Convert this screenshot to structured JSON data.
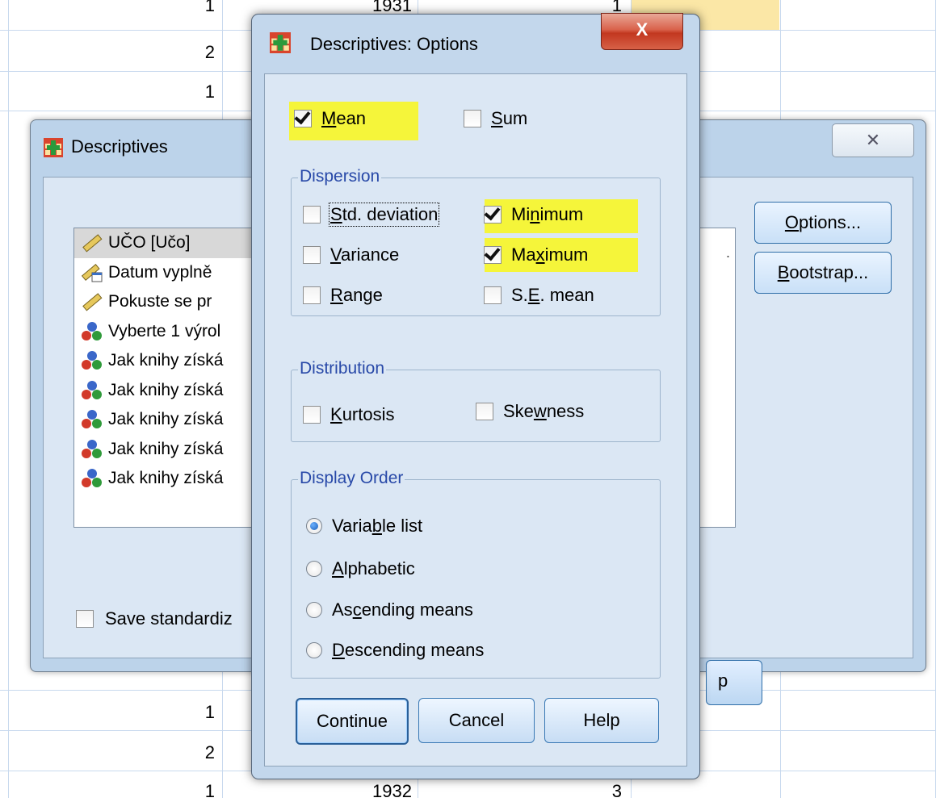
{
  "sheet": {
    "rows": [
      {
        "a": "1",
        "b": "1931",
        "c": "1"
      },
      {
        "a": "2",
        "b": "",
        "c": ""
      },
      {
        "a": "1",
        "b": "",
        "c": ""
      },
      {
        "a": "1",
        "b": "",
        "c": ""
      },
      {
        "a": "2",
        "b": "",
        "c": ""
      },
      {
        "a": "1",
        "b": "1932",
        "c": "3"
      }
    ]
  },
  "back_dialog": {
    "title": "Descriptives",
    "close_glyph": "✕",
    "variables": [
      {
        "label": "UČO [Učo]",
        "icon": "ruler-scale-icon"
      },
      {
        "label": "Datum vyplně",
        "icon": "date-scale-icon"
      },
      {
        "label": "Pokuste se pr",
        "icon": "ruler-scale-icon"
      },
      {
        "label": "Vyberte 1 výrol",
        "icon": "nominal-icon"
      },
      {
        "label": "Jak knihy získá",
        "icon": "nominal-icon"
      },
      {
        "label": "Jak knihy získá",
        "icon": "nominal-icon"
      },
      {
        "label": "Jak knihy získá",
        "icon": "nominal-icon"
      },
      {
        "label": "Jak knihy získá",
        "icon": "nominal-icon"
      },
      {
        "label": "Jak knihy získá",
        "icon": "nominal-icon"
      }
    ],
    "target_ellipsis": ".",
    "options_button": {
      "pre": "",
      "key": "O",
      "post": "ptions..."
    },
    "bootstrap_button": {
      "pre": "",
      "key": "B",
      "post": "ootstrap..."
    },
    "save_standardized": "Save standardiz",
    "bottom_partial_label": "p"
  },
  "options_dialog": {
    "title": "Descriptives: Options",
    "close_glyph": "X",
    "mean": {
      "pre": "",
      "key": "M",
      "post": "ean",
      "checked": true
    },
    "sum": {
      "pre": "",
      "key": "S",
      "post": "um",
      "checked": false
    },
    "dispersion": {
      "legend": "Dispersion",
      "std_deviation": {
        "pre": "",
        "key": "S",
        "post": "td. deviation",
        "checked": false
      },
      "minimum": {
        "pre": "Mi",
        "key": "n",
        "post": "imum",
        "checked": true
      },
      "variance": {
        "pre": "",
        "key": "V",
        "post": "ariance",
        "checked": false
      },
      "maximum": {
        "pre": "Ma",
        "key": "x",
        "post": "imum",
        "checked": true
      },
      "range": {
        "pre": "",
        "key": "R",
        "post": "ange",
        "checked": false
      },
      "se_mean": {
        "pre": "S.",
        "key": "E",
        "post": ". mean",
        "checked": false
      }
    },
    "distribution": {
      "legend": "Distribution",
      "kurtosis": {
        "pre": "",
        "key": "K",
        "post": "urtosis",
        "checked": false
      },
      "skewness": {
        "pre": "Ske",
        "key": "w",
        "post": "ness",
        "checked": false
      }
    },
    "display_order": {
      "legend": "Display Order",
      "variable_list": {
        "pre": "Varia",
        "key": "b",
        "post": "le list",
        "selected": true
      },
      "alphabetic": {
        "pre": "",
        "key": "A",
        "post": "lphabetic",
        "selected": false
      },
      "ascending": {
        "pre": "As",
        "key": "c",
        "post": "ending means",
        "selected": false
      },
      "descending": {
        "pre": "",
        "key": "D",
        "post": "escending means",
        "selected": false
      }
    },
    "buttons": {
      "continue": "Continue",
      "cancel": "Cancel",
      "help": "Help"
    }
  },
  "colors": {
    "highlight": "#f5f53a",
    "legend_text": "#2849a8",
    "grid": "#c8d9ee",
    "close_red": "#c2371f"
  }
}
